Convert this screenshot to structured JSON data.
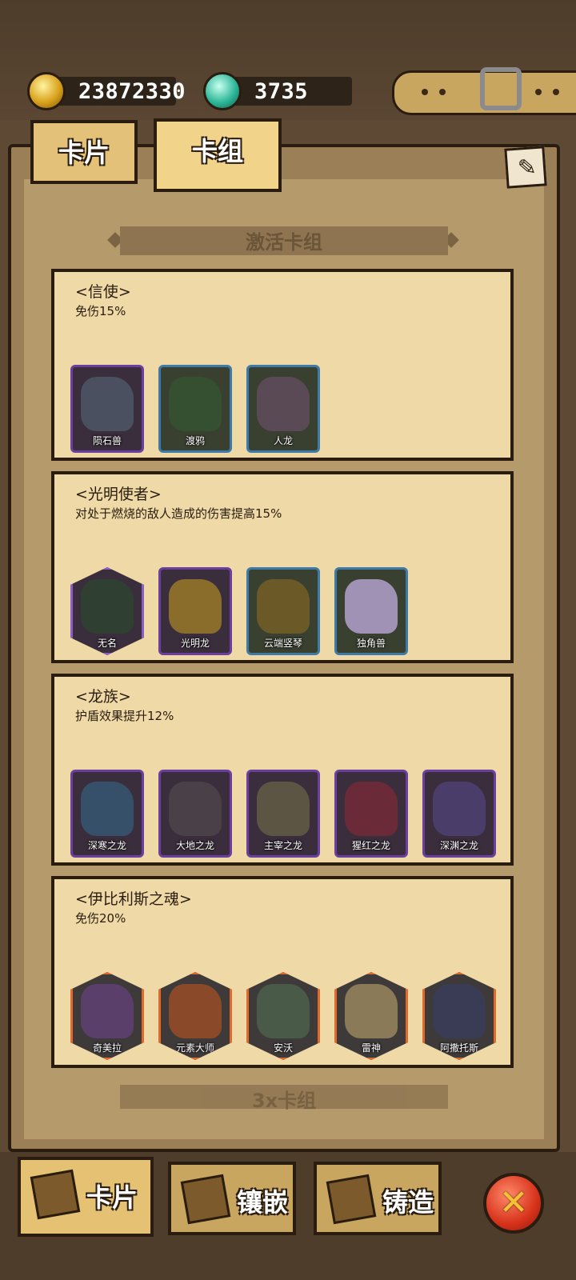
{
  "currency": {
    "gold": {
      "icon": "gold-coin-icon",
      "value": "23872330"
    },
    "gem": {
      "icon": "gem-icon",
      "value": "3735"
    }
  },
  "tabs": [
    {
      "label": "卡片",
      "active": false
    },
    {
      "label": "卡组",
      "active": true
    }
  ],
  "edit_icon": "edit-pencil-icon",
  "section_title": "激活卡组",
  "section_title_next": "3x卡组",
  "groups": [
    {
      "name": "<信使>",
      "desc": "免伤15%",
      "cards": [
        {
          "name": "陨石兽",
          "frame": "purple",
          "art": "#4a5060"
        },
        {
          "name": "渡鸦",
          "frame": "blue",
          "art": "#355030"
        },
        {
          "name": "人龙",
          "frame": "blue",
          "art": "#5a4a55"
        }
      ]
    },
    {
      "name": "<光明使者>",
      "desc": "对处于燃烧的敌人造成的伤害提高15%",
      "cards": [
        {
          "name": "无名",
          "frame": "hex-purple",
          "art": "#2f4032"
        },
        {
          "name": "光明龙",
          "frame": "purple",
          "art": "#8a6d2a"
        },
        {
          "name": "云端竖琴",
          "frame": "blue",
          "art": "#6b5a28"
        },
        {
          "name": "独角兽",
          "frame": "blue",
          "art": "#9f92b5"
        }
      ]
    },
    {
      "name": "<龙族>",
      "desc": "护盾效果提升12%",
      "cards": [
        {
          "name": "深寒之龙",
          "frame": "purple",
          "art": "#37506a"
        },
        {
          "name": "大地之龙",
          "frame": "purple",
          "art": "#4a4048"
        },
        {
          "name": "主宰之龙",
          "frame": "purple",
          "art": "#5c5544"
        },
        {
          "name": "猩红之龙",
          "frame": "purple",
          "art": "#6a2a38"
        },
        {
          "name": "深渊之龙",
          "frame": "purple",
          "art": "#4a3d6a"
        }
      ]
    },
    {
      "name": "<伊比利斯之魂>",
      "desc": "免伤20%",
      "cards": [
        {
          "name": "奇美拉",
          "frame": "orange",
          "art": "#5a3f6b"
        },
        {
          "name": "元素大师",
          "frame": "orange",
          "art": "#8a4a2a"
        },
        {
          "name": "安沃",
          "frame": "orange",
          "art": "#4a5a48"
        },
        {
          "name": "雷神",
          "frame": "orange",
          "art": "#8a7a58"
        },
        {
          "name": "阿撒托斯",
          "frame": "orange",
          "art": "#3a3c55"
        }
      ]
    }
  ],
  "nav": [
    {
      "label": "卡片",
      "icon": "cards-icon",
      "active": true
    },
    {
      "label": "镶嵌",
      "icon": "inlay-book-icon",
      "active": false
    },
    {
      "label": "铸造",
      "icon": "forge-icon",
      "active": false
    }
  ],
  "close_icon": "close-icon",
  "close_symbol": "✕",
  "colors": {
    "frame_purple": "#6b3fa0",
    "frame_blue": "#3d7aa8",
    "frame_orange": "#e06a2a",
    "parchment": "#efd9a6"
  }
}
